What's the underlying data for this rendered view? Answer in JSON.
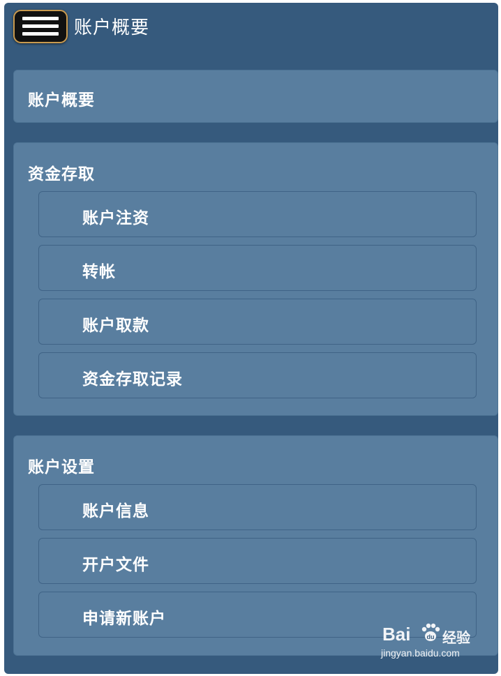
{
  "header": {
    "menu_icon": "hamburger-menu-icon",
    "title": "账户概要"
  },
  "nav": {
    "overview": {
      "label": "账户概要"
    },
    "funds": {
      "label": "资金存取",
      "items": [
        {
          "label": "账户注资"
        },
        {
          "label": "转帐"
        },
        {
          "label": "账户取款"
        },
        {
          "label": "资金存取记录"
        }
      ]
    },
    "settings": {
      "label": "账户设置",
      "items": [
        {
          "label": "账户信息"
        },
        {
          "label": "开户文件"
        },
        {
          "label": "申请新账户"
        }
      ]
    }
  },
  "watermark": {
    "brand": "Bai",
    "brand_suffix": "经验",
    "url": "jingyan.baidu.com",
    "icon": "baidu-paw-icon"
  },
  "colors": {
    "background": "#365a7d",
    "panel": "#597e9f",
    "menu_button": "#111111",
    "menu_button_border": "#c99a4f",
    "text": "#ffffff"
  }
}
